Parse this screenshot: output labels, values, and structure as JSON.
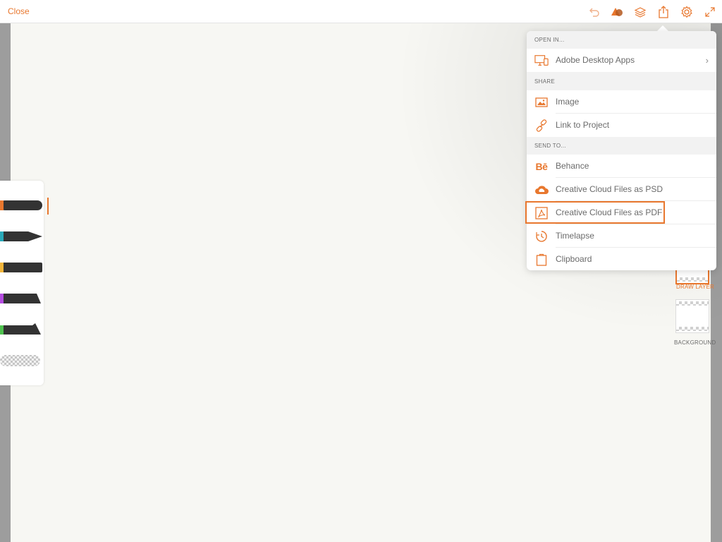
{
  "topbar": {
    "close_label": "Close",
    "icons": [
      "undo-icon",
      "shape-icon",
      "layers-icon",
      "share-icon",
      "settings-icon",
      "expand-icon"
    ]
  },
  "colors": {
    "accent": "#e8772e",
    "canvas": "#f7f7f3",
    "side": "#9d9d9d"
  },
  "brushes": [
    {
      "name": "brush-1",
      "color": "#e8772e",
      "selected": true
    },
    {
      "name": "brush-2",
      "color": "#2aa8b8"
    },
    {
      "name": "brush-3",
      "color": "#f2b53b"
    },
    {
      "name": "brush-4",
      "color": "#b44de0"
    },
    {
      "name": "brush-5",
      "color": "#4fc24f"
    },
    {
      "name": "eraser"
    }
  ],
  "layers": {
    "draw_layer_label": "DRAW LAYER",
    "background_label": "BACKGROUND"
  },
  "popover": {
    "open_in": {
      "header": "OPEN IN...",
      "items": [
        {
          "label": "Adobe Desktop Apps",
          "icon": "desktop-apps-icon",
          "has_chevron": true
        }
      ]
    },
    "share": {
      "header": "SHARE",
      "items": [
        {
          "label": "Image",
          "icon": "image-icon"
        },
        {
          "label": "Link to Project",
          "icon": "link-icon"
        }
      ]
    },
    "send_to": {
      "header": "SEND TO...",
      "items": [
        {
          "label": "Behance",
          "icon": "behance-icon"
        },
        {
          "label": "Creative Cloud Files as PSD",
          "icon": "creative-cloud-icon"
        },
        {
          "label": "Creative Cloud Files as PDF",
          "icon": "pdf-icon",
          "highlighted": true
        },
        {
          "label": "Timelapse",
          "icon": "timelapse-icon"
        },
        {
          "label": "Clipboard",
          "icon": "clipboard-icon"
        }
      ]
    }
  }
}
